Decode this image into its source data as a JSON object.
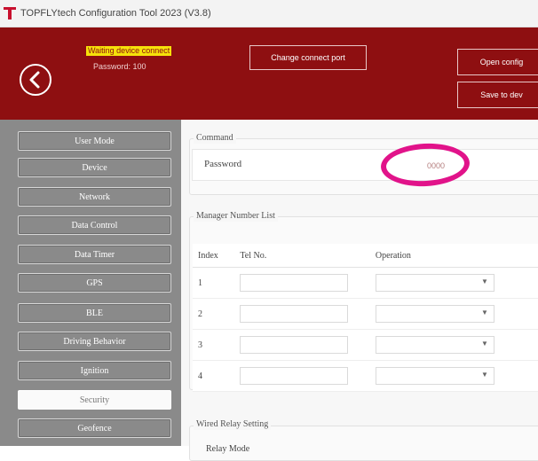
{
  "window": {
    "title": "TOPFLYtech Configuration Tool 2023 (V3.8)"
  },
  "header": {
    "status": "Waiting device connect",
    "password_line": "Password: 100",
    "change_port_button": "Change connect port",
    "open_config_button": "Open config",
    "save_to_button": "Save to dev"
  },
  "sidebar": {
    "items": [
      {
        "label": "User Mode"
      },
      {
        "label": "Device"
      },
      {
        "label": "Network"
      },
      {
        "label": "Data Control"
      },
      {
        "label": "Data Timer"
      },
      {
        "label": "GPS"
      },
      {
        "label": "BLE"
      },
      {
        "label": "Driving Behavior"
      },
      {
        "label": "Ignition"
      },
      {
        "label": "Security"
      },
      {
        "label": "Geofence"
      }
    ],
    "active_index": 9
  },
  "command": {
    "legend": "Command",
    "password_label": "Password",
    "password_value": "0000"
  },
  "manager_list": {
    "legend": "Manager Number List",
    "columns": [
      "Index",
      "Tel No.",
      "Operation"
    ],
    "rows": [
      {
        "index": "1"
      },
      {
        "index": "2"
      },
      {
        "index": "3"
      },
      {
        "index": "4"
      }
    ]
  },
  "wired_relay": {
    "legend": "Wired Relay Setting",
    "relay_mode_label": "Relay Mode"
  },
  "colors": {
    "header_bg": "#8e0f11",
    "status_highlight": "#f6e20a",
    "sidebar_bg": "#8a8a8a",
    "annotation_circle": "#e1138a"
  }
}
